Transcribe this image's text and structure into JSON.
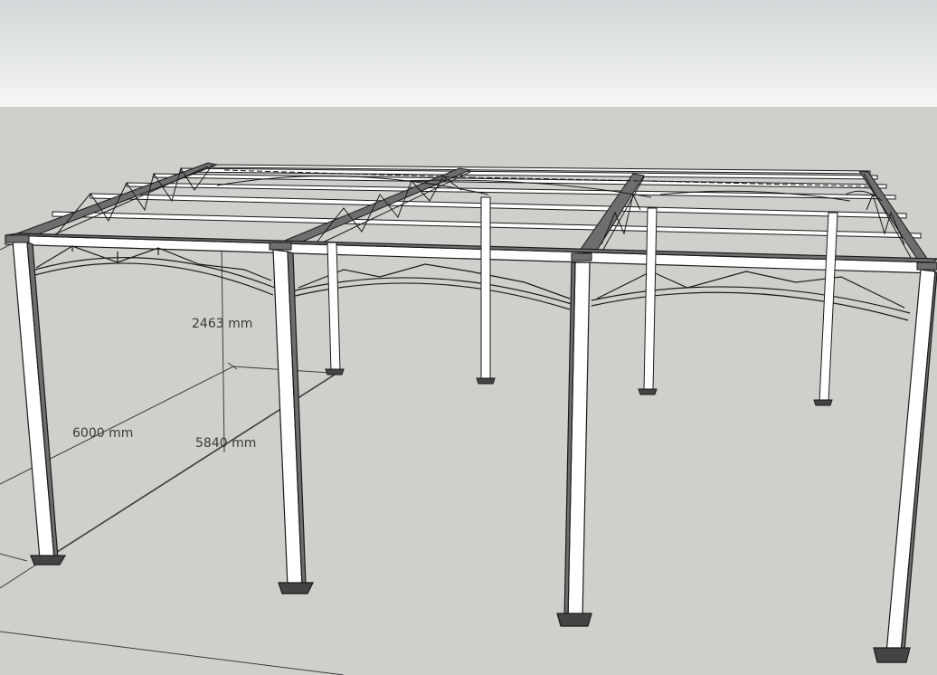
{
  "colors": {
    "sky_top": "#d6d9da",
    "sky_bottom": "#f4f5f5",
    "ground": "#cfcfcb",
    "steel_fill": "#ffffff",
    "steel_shadow": "#6e6e6e",
    "edge": "#1a1a1a",
    "dimension_text": "#3a3a3a"
  },
  "dimensions": {
    "height": "2463 mm",
    "length": "6000 mm",
    "width": "5840 mm"
  }
}
